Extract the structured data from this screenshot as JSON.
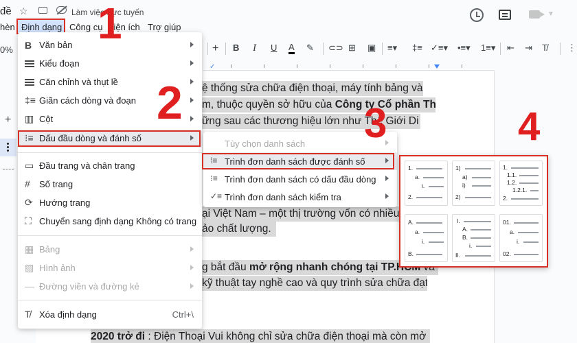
{
  "titlebar": {
    "doc_title": "đề",
    "online_status": "Làm việc trực tuyến"
  },
  "menubar": {
    "items": [
      "hèn",
      "Định dạng",
      "Công cụ",
      "Tiện ích",
      "Trợ giúp"
    ]
  },
  "toolbar": {
    "zoom_fragment": "0%",
    "plus_symbol": "+"
  },
  "format_menu": {
    "items": [
      {
        "label": "Văn bản",
        "icon": "bold-icon"
      },
      {
        "label": "Kiểu đoạn",
        "icon": "paragraph-style-icon"
      },
      {
        "label": "Căn chỉnh và thụt lề",
        "icon": "indent-icon"
      },
      {
        "label": "Giãn cách dòng và đoạn",
        "icon": "line-spacing-icon"
      },
      {
        "label": "Cột",
        "icon": "columns-icon"
      },
      {
        "label": "Dấu đầu dòng và đánh số",
        "icon": "bullet-list-icon"
      },
      {
        "label": "Đầu trang và chân trang",
        "icon": "header-footer-icon"
      },
      {
        "label": "Số trang",
        "icon": "hash-icon"
      },
      {
        "label": "Hướng trang",
        "icon": "orientation-icon"
      },
      {
        "label": "Chuyển sang định dạng Không có trang",
        "icon": "pageless-icon"
      },
      {
        "label": "Bảng",
        "icon": "table-icon"
      },
      {
        "label": "Hình ảnh",
        "icon": "image-icon"
      },
      {
        "label": "Đường viền và đường kẻ",
        "icon": "border-icon"
      },
      {
        "label": "Xóa định dạng",
        "icon": "clear-format-icon",
        "shortcut": "Ctrl+\\"
      }
    ]
  },
  "submenu": {
    "items": [
      {
        "label": "Tùy chọn danh sách",
        "disabled": true
      },
      {
        "label": "Trình đơn danh sách được đánh số",
        "icon": "numbered-list-icon"
      },
      {
        "label": "Trình đơn danh sách có dấu đầu dòng",
        "icon": "bulleted-list-icon"
      },
      {
        "label": "Trình đơn danh sách kiểm tra",
        "icon": "checklist-icon"
      }
    ]
  },
  "presets": {
    "p1": [
      "1.",
      "a.",
      "i.",
      "2."
    ],
    "p2": [
      "1)",
      "a)",
      "i)",
      "2)"
    ],
    "p3": [
      "1.",
      "1.1.",
      "1.2.",
      "1.2.1.",
      "2."
    ],
    "p4": [
      "A.",
      "a.",
      "i.",
      "B."
    ],
    "p5": [
      "I.",
      "A.",
      "B.",
      "i.",
      "II."
    ],
    "p6": [
      "01.",
      "a.",
      "i.",
      "02."
    ]
  },
  "document": {
    "lines": [
      "ệ thống sửa chữa điện thoại, máy tính bảng và",
      "m, thuộc quyền sở hữu của ",
      "ững sau các thương hiệu lớn như Thế Giới Di",
      "ại Việt Nam – một thị trường vốn có nhiều",
      "ảo chất lượng.",
      "g bắt đầu ",
      "kỹ thuật tay nghề cao và quy trình sửa chữa đạt",
      ": Điện Thoại Vui không chỉ sửa chữa điện thoại mà còn mở"
    ],
    "bold_company": "Công ty Cổ phần Thế",
    "bold_expand": "mở rộng nhanh chóng tại TP.HCM",
    "expand_tail": " và Hà",
    "bold_year": "2020 trở đi"
  },
  "annotations": {
    "n1": "1",
    "n2": "2",
    "n3": "3",
    "n4": "4",
    "color": "#e02020"
  }
}
